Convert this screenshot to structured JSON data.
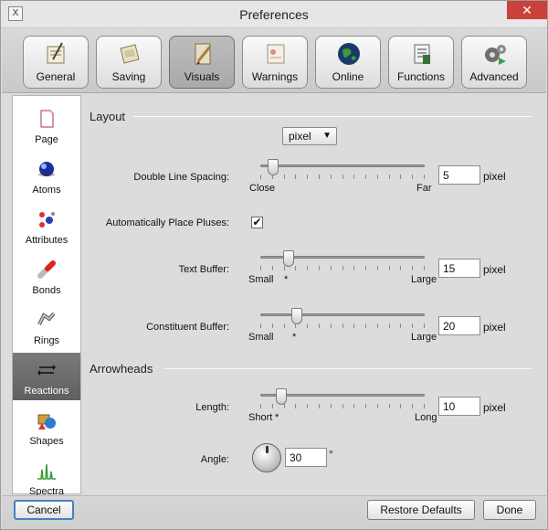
{
  "window": {
    "title": "Preferences",
    "app_icon_glyph": "X",
    "close_glyph": "✕"
  },
  "toolbar": {
    "tabs": [
      {
        "label": "General",
        "icon": "general-icon",
        "active": false
      },
      {
        "label": "Saving",
        "icon": "saving-icon",
        "active": false
      },
      {
        "label": "Visuals",
        "icon": "visuals-icon",
        "active": true
      },
      {
        "label": "Warnings",
        "icon": "warnings-icon",
        "active": false
      },
      {
        "label": "Online",
        "icon": "globe-icon",
        "active": false
      },
      {
        "label": "Functions",
        "icon": "functions-icon",
        "active": false
      },
      {
        "label": "Advanced",
        "icon": "gears-icon",
        "active": false
      }
    ]
  },
  "sidebar": {
    "items": [
      {
        "label": "Page",
        "icon": "page-icon",
        "active": false
      },
      {
        "label": "Atoms",
        "icon": "atom-icon",
        "active": false
      },
      {
        "label": "Attributes",
        "icon": "attributes-icon",
        "active": false
      },
      {
        "label": "Bonds",
        "icon": "bond-icon",
        "active": false
      },
      {
        "label": "Rings",
        "icon": "ring-icon",
        "active": false
      },
      {
        "label": "Reactions",
        "icon": "reaction-arrows-icon",
        "active": true
      },
      {
        "label": "Shapes",
        "icon": "shapes-icon",
        "active": false
      },
      {
        "label": "Spectra",
        "icon": "spectra-icon",
        "active": false
      }
    ]
  },
  "layout": {
    "section_title": "Layout",
    "unit_select": "pixel",
    "double_line_spacing": {
      "label": "Double Line Spacing:",
      "min_label": "Close",
      "max_label": "Far",
      "value": "5",
      "unit": "pixel",
      "position": 0.05
    },
    "auto_place_pluses": {
      "label": "Automatically Place Pluses:",
      "checked": true,
      "check_glyph": "✔"
    },
    "text_buffer": {
      "label": "Text Buffer:",
      "min_label": "Small",
      "max_label": "Large",
      "value": "15",
      "unit": "pixel",
      "position": 0.15
    },
    "constituent_buffer": {
      "label": "Constituent Buffer:",
      "min_label": "Small",
      "max_label": "Large",
      "value": "20",
      "unit": "pixel",
      "position": 0.2
    }
  },
  "arrowheads": {
    "section_title": "Arrowheads",
    "length": {
      "label": "Length:",
      "min_label": "Short",
      "max_label": "Long",
      "value": "10",
      "unit": "pixel",
      "position": 0.1
    },
    "angle": {
      "label": "Angle:",
      "value": "30",
      "unit": "°"
    }
  },
  "footer": {
    "cancel_label": "Cancel",
    "restore_label": "Restore Defaults",
    "done_label": "Done"
  },
  "star_glyph": "*"
}
